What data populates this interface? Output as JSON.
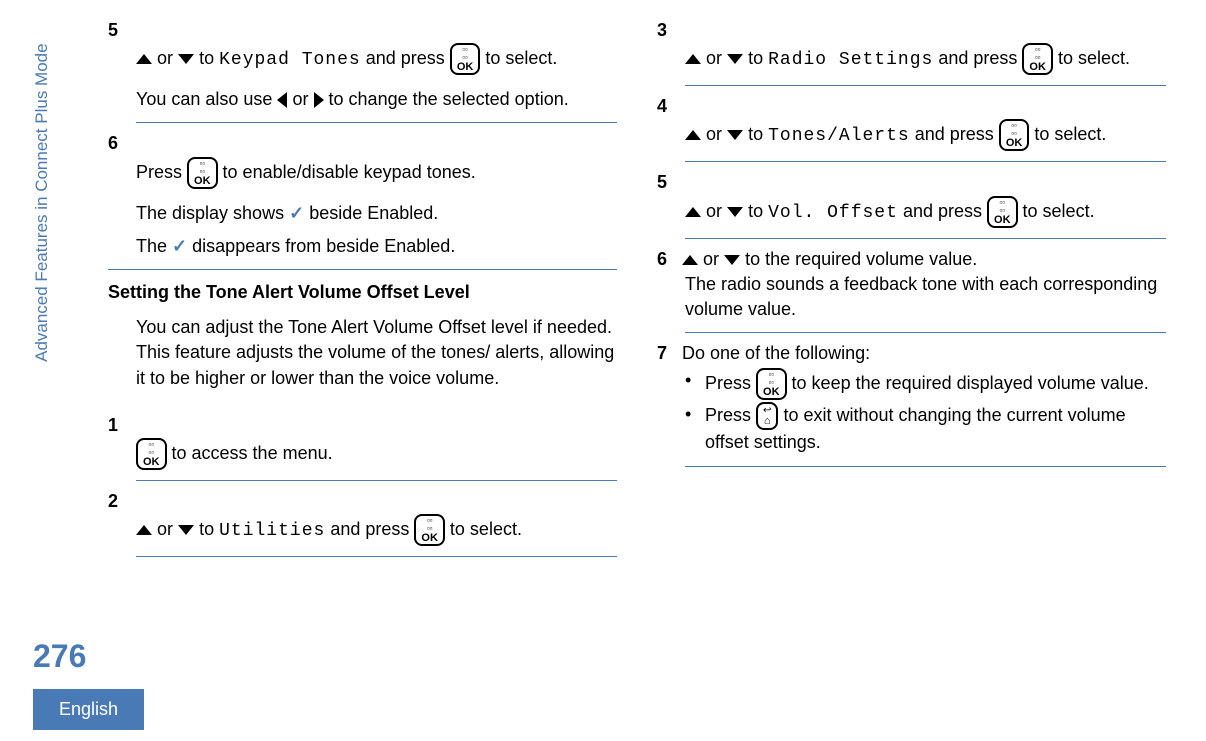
{
  "sidebar": "Advanced Features in Connect Plus Mode",
  "page_number": "276",
  "language": "English",
  "text": {
    "or": "or",
    "to": "to",
    "and_press": "and press",
    "to_select": "to select.",
    "press": "Press"
  },
  "left": {
    "step5_a": "to",
    "step5_mono": "Keypad Tones",
    "step5_end": "to select.",
    "step5_note_a": "You can also use",
    "step5_note_b": "to change the selected option.",
    "step6_a": "to enable/disable keypad tones.",
    "step6_b": "The display shows",
    "step6_c": "beside Enabled.",
    "step6_d": "The",
    "step6_e": "disappears from beside Enabled.",
    "heading": "Setting the Tone Alert Volume Offset Level",
    "para": "You can adjust the Tone Alert Volume Offset level if needed. This feature adjusts the volume of the tones/ alerts, allowing it to be higher or lower than the voice volume.",
    "step1": "to access the menu.",
    "step2_mono": "Utilities",
    "step2_end": "to select."
  },
  "right": {
    "step3_mono": "Radio Settings",
    "step4_mono": "Tones/Alerts",
    "step5_mono": "Vol. Offset",
    "step6_a": "to the required volume value.",
    "step6_b": "The radio sounds a feedback tone with each corresponding volume value.",
    "step7_a": "Do one of the following:",
    "bullet1": "to keep the required displayed volume value.",
    "bullet2": "to exit without changing the current volume offset settings."
  },
  "nums": {
    "n1": "1",
    "n2": "2",
    "n3": "3",
    "n4": "4",
    "n5": "5",
    "n6": "6",
    "n7": "7"
  }
}
